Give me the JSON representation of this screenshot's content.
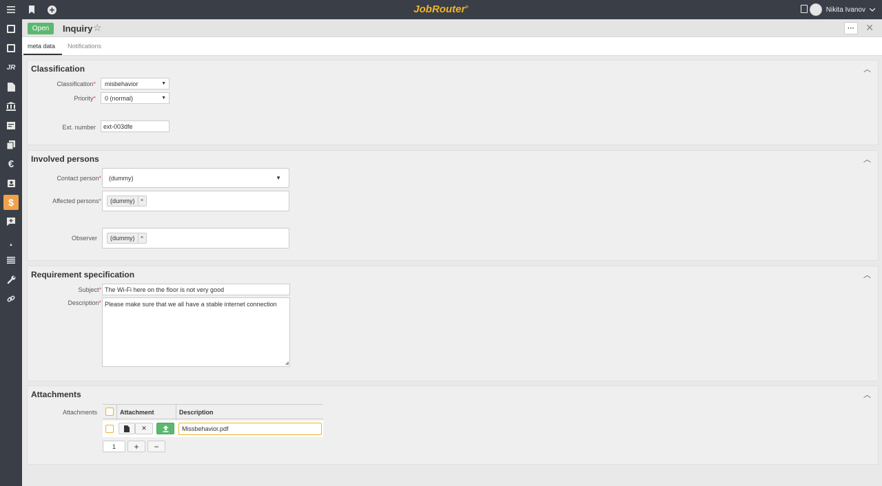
{
  "app": {
    "logo": "JobRouter"
  },
  "topbar": {
    "user_name": "Nikita Ivanov"
  },
  "header": {
    "status_button": "Open",
    "title": "Inquiry"
  },
  "tabs": [
    {
      "label": "meta data"
    },
    {
      "label": "Notifications"
    }
  ],
  "classification": {
    "title": "Classification",
    "classification_label": "Classification",
    "classification_value": "misbehavior",
    "priority_label": "Priority",
    "priority_value": "0 (normal)",
    "ext_number_label": "Ext. number",
    "ext_number_value": "ext-003dfe"
  },
  "involved": {
    "title": "Involved persons",
    "contact_label": "Contact person",
    "contact_value": "(dummy)",
    "affected_label": "Affected persons",
    "affected_tag": "(dummy)",
    "observer_label": "Observer",
    "observer_tag": "(dummy)"
  },
  "requirement": {
    "title": "Requirement specification",
    "subject_label": "Subject",
    "subject_value": "The Wi-Fi here on the floor is not very good",
    "description_label": "Description",
    "description_value": "Please make sure that we all have a stable internet connection"
  },
  "attachments": {
    "title": "Attachments",
    "field_label": "Attachments",
    "col_attachment": "Attachment",
    "col_description": "Description",
    "rows": [
      {
        "description": "Missbehavior.pdf"
      }
    ],
    "count": "1"
  },
  "symbols": {
    "required": "*",
    "tag_remove": "×",
    "plus": "+",
    "minus": "−"
  }
}
